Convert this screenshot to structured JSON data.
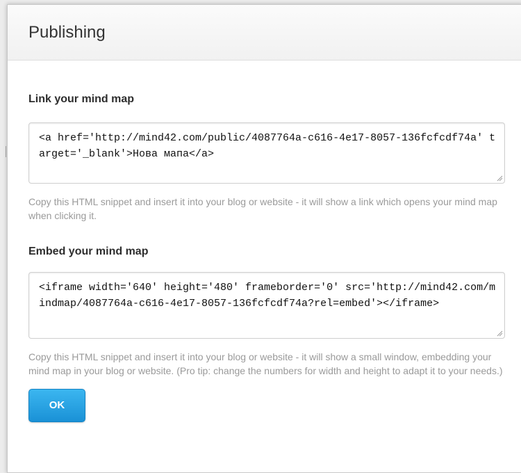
{
  "dialog": {
    "title": "Publishing",
    "ok_label": "OK"
  },
  "link_section": {
    "heading": "Link your mind map",
    "snippet": "<a href='http://mind42.com/public/4087764a-c616-4e17-8057-136fcfcdf74a' target='_blank'>Нова мапа</a>",
    "help": "Copy this HTML snippet and insert it into your blog or website - it will show a link which opens your mind map when clicking it."
  },
  "embed_section": {
    "heading": "Embed your mind map",
    "snippet": "<iframe width='640' height='480' frameborder='0' src='http://mind42.com/mindmap/4087764a-c616-4e17-8057-136fcfcdf74a?rel=embed'></iframe>",
    "help": "Copy this HTML snippet and insert it into your blog or website - it will show a small window, embedding your mind map in your blog or website. (Pro tip: change the numbers for width and height to adapt it to your needs.)"
  },
  "colors": {
    "accent": "#1a91d6",
    "text": "#2d2d2d",
    "muted": "#9a9a9a"
  }
}
